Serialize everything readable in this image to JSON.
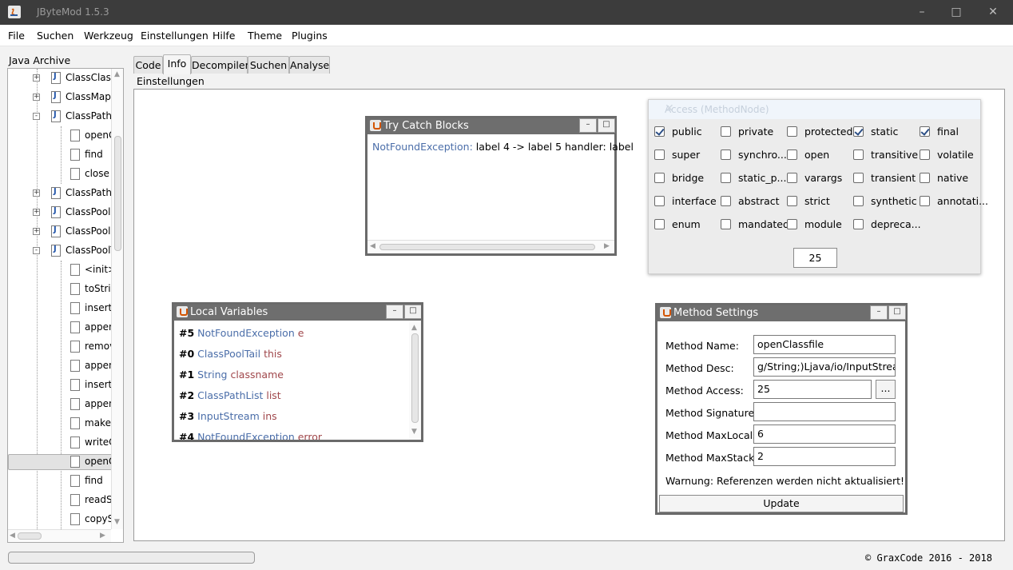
{
  "window": {
    "title": "JByteMod 1.5.3"
  },
  "menu": [
    "File",
    "Suchen",
    "Werkzeug",
    "Einstellungen",
    "Hilfe",
    "Theme",
    "Plugins"
  ],
  "sidebar": {
    "header": "Java Archive",
    "tree": [
      {
        "label": "ClassClassP",
        "type": "class",
        "expander": "+"
      },
      {
        "label": "ClassMap.c",
        "type": "class",
        "expander": "+"
      },
      {
        "label": "ClassPath.c",
        "type": "class",
        "expander": "-"
      },
      {
        "label": "openC",
        "type": "method"
      },
      {
        "label": "find",
        "type": "method"
      },
      {
        "label": "close",
        "type": "method"
      },
      {
        "label": "ClassPathL",
        "type": "class",
        "expander": "+"
      },
      {
        "label": "ClassPool$",
        "type": "class",
        "expander": "+"
      },
      {
        "label": "ClassPool.c",
        "type": "class",
        "expander": "+"
      },
      {
        "label": "ClassPoolT",
        "type": "class",
        "expander": "-"
      },
      {
        "label": "<init>",
        "type": "method"
      },
      {
        "label": "toStrin",
        "type": "method"
      },
      {
        "label": "insertC",
        "type": "method"
      },
      {
        "label": "appen",
        "type": "method"
      },
      {
        "label": "remov",
        "type": "method"
      },
      {
        "label": "appen",
        "type": "method"
      },
      {
        "label": "insertC",
        "type": "method"
      },
      {
        "label": "appen",
        "type": "method"
      },
      {
        "label": "makeP",
        "type": "method"
      },
      {
        "label": "writeC",
        "type": "method"
      },
      {
        "label": "openC",
        "type": "method",
        "selected": true
      },
      {
        "label": "find",
        "type": "method"
      },
      {
        "label": "readSt",
        "type": "method"
      },
      {
        "label": "copyS",
        "type": "method"
      }
    ]
  },
  "tabs": [
    "Code",
    "Info",
    "Decompiler",
    "Suchen",
    "Analyse"
  ],
  "active_tab": "Info",
  "settings_label": "Einstellungen",
  "try_catch": {
    "title": "Try Catch Blocks",
    "exception": "NotFoundException:",
    "entry": " label 4 -> label 5 handler: label"
  },
  "local_vars": {
    "title": "Local Variables",
    "rows": [
      {
        "index": "#5",
        "type": "NotFoundException",
        "name": "e"
      },
      {
        "index": "#0",
        "type": "ClassPoolTail",
        "name": "this"
      },
      {
        "index": "#1",
        "type": "String",
        "name": "classname"
      },
      {
        "index": "#2",
        "type": "ClassPathList",
        "name": "list"
      },
      {
        "index": "#3",
        "type": "InputStream",
        "name": "ins"
      },
      {
        "index": "#4",
        "type": "NotFoundException",
        "name": "error"
      }
    ]
  },
  "access": {
    "title": "Access (MethodNode)",
    "flags": [
      {
        "label": "public",
        "checked": true
      },
      {
        "label": "private",
        "checked": false
      },
      {
        "label": "protected",
        "checked": false
      },
      {
        "label": "static",
        "checked": true
      },
      {
        "label": "final",
        "checked": true
      },
      {
        "label": "super",
        "checked": false
      },
      {
        "label": "synchro...",
        "checked": false
      },
      {
        "label": "open",
        "checked": false
      },
      {
        "label": "transitive",
        "checked": false
      },
      {
        "label": "volatile",
        "checked": false
      },
      {
        "label": "bridge",
        "checked": false
      },
      {
        "label": "static_p...",
        "checked": false
      },
      {
        "label": "varargs",
        "checked": false
      },
      {
        "label": "transient",
        "checked": false
      },
      {
        "label": "native",
        "checked": false
      },
      {
        "label": "interface",
        "checked": false
      },
      {
        "label": "abstract",
        "checked": false
      },
      {
        "label": "strict",
        "checked": false
      },
      {
        "label": "synthetic",
        "checked": false
      },
      {
        "label": "annotati...",
        "checked": false
      },
      {
        "label": "enum",
        "checked": false
      },
      {
        "label": "mandated",
        "checked": false
      },
      {
        "label": "module",
        "checked": false
      },
      {
        "label": "depreca...",
        "checked": false
      }
    ],
    "value": "25"
  },
  "method_settings": {
    "title": "Method Settings",
    "labels": {
      "name": "Method Name:",
      "desc": "Method Desc:",
      "access": "Method Access:",
      "signature": "Method Signature:",
      "maxlocals": "Method MaxLocals:",
      "maxstack": "Method MaxStack:"
    },
    "values": {
      "name": "openClassfile",
      "desc": "g/String;)Ljava/io/InputStream;",
      "access": "25",
      "signature": "",
      "maxlocals": "6",
      "maxstack": "2"
    },
    "access_button": "...",
    "warning": "Warnung: Referenzen werden nicht aktualisiert!",
    "update_button": "Update"
  },
  "footer": {
    "copyright": "© GraxCode 2016 - 2018"
  }
}
